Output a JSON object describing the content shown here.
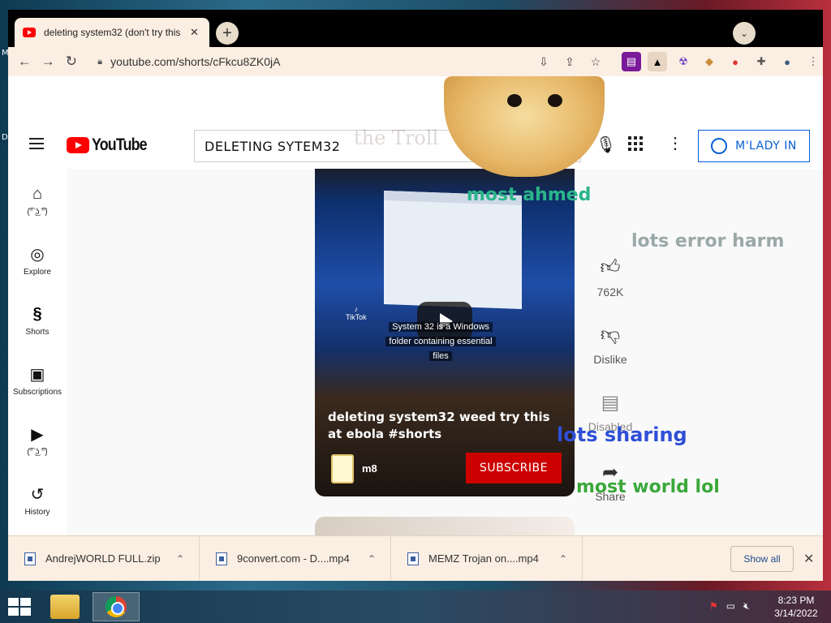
{
  "desktop": {
    "side_letters": [
      "M",
      "D"
    ]
  },
  "browser": {
    "tab": {
      "title": "deleting system32 (don't try this"
    },
    "url": "youtube.com/shorts/cFkcu8ZK0jA"
  },
  "youtube": {
    "logo_text": "YouTube",
    "search_value": "DELETING SYTEM32",
    "signin_label": "M'LADY IN",
    "sidebar": [
      {
        "icon": "home-icon",
        "label": "(͡° ͜ʖ ͡°)"
      },
      {
        "icon": "explore-icon",
        "label": "Explore"
      },
      {
        "icon": "shorts-icon",
        "label": "Shorts"
      },
      {
        "icon": "subscriptions-icon",
        "label": "Subscriptions"
      },
      {
        "icon": "library-icon",
        "label": "(͡° ͜ʖ ͡°)"
      },
      {
        "icon": "history-icon",
        "label": "History"
      }
    ],
    "video": {
      "tiktok_label": "TikTok",
      "caption_lines": [
        "System 32 is a Windows",
        "folder containing essential",
        "files"
      ],
      "title": "deleting system32 weed try this at ebola #shorts",
      "channel": "m8",
      "subscribe_label": "SUBSCRIBE"
    },
    "actions": {
      "likes": "762K",
      "dislike": "Dislike",
      "comments": "Disabled",
      "share": "Share"
    }
  },
  "overlays": {
    "ghost": "the Troll",
    "most_ahmed": "most ahmed",
    "lots_error_harm": "lots error harm",
    "lots_sharing": "lots sharing",
    "most_world_lol": "most world lol"
  },
  "downloads": {
    "items": [
      {
        "name": "AndrejWORLD FULL.zip"
      },
      {
        "name": "9convert.com - D....mp4"
      },
      {
        "name": "MEMZ Trojan on....mp4"
      }
    ],
    "show_all": "Show all"
  },
  "taskbar": {
    "time": "8:23 PM",
    "date": "3/14/2022"
  },
  "colors": {
    "chrome_frame": "#fbeee2",
    "youtube_red": "#ff0000",
    "subscribe_red": "#cc0000",
    "signin_blue": "#065fd4"
  }
}
